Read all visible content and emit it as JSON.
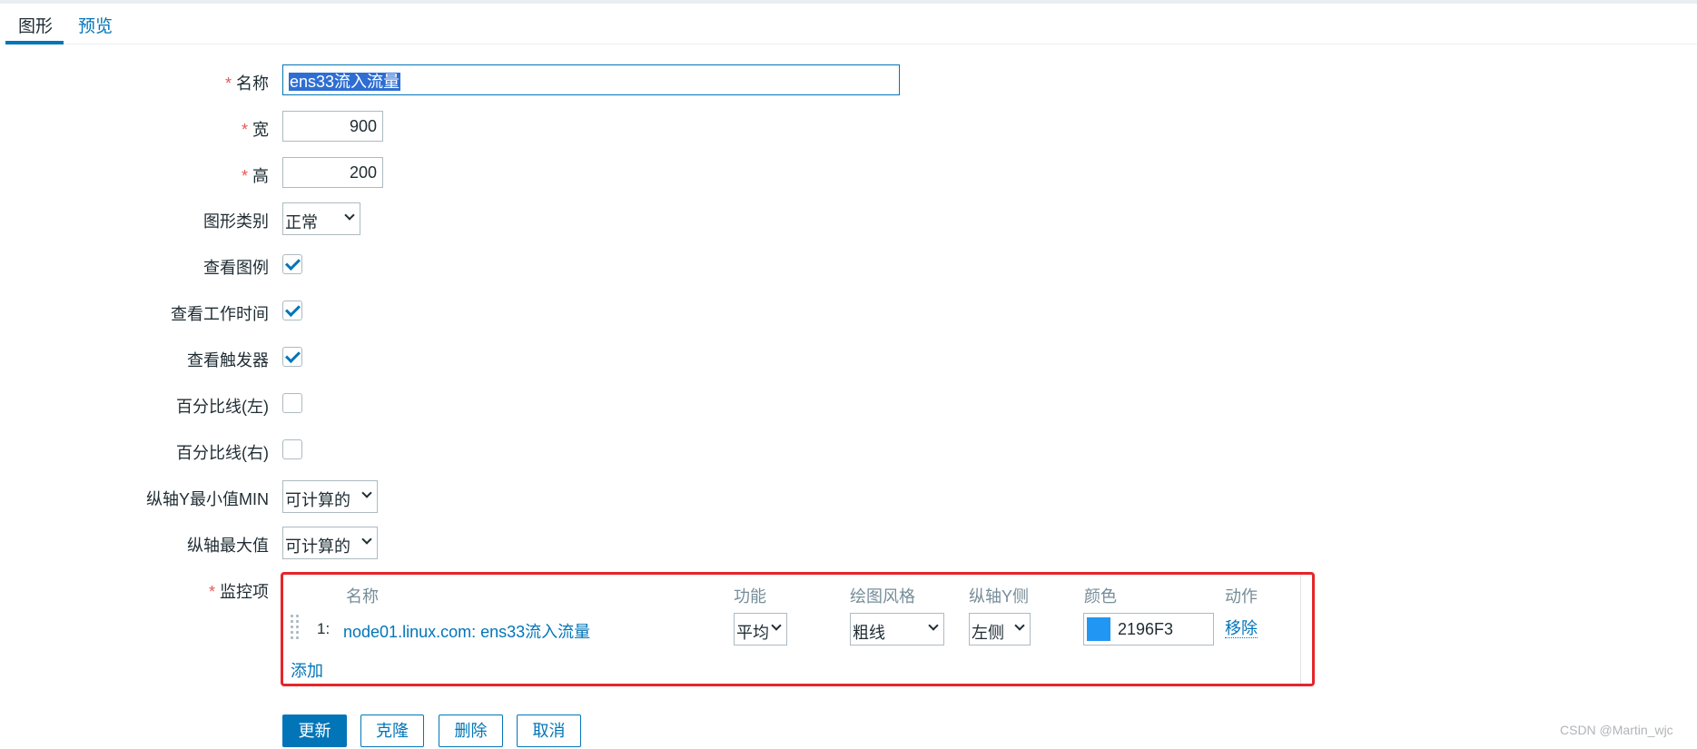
{
  "tabs": [
    {
      "label": "图形"
    },
    {
      "label": "预览"
    }
  ],
  "form": {
    "name": {
      "label": "名称",
      "value": "ens33流入流量"
    },
    "width": {
      "label": "宽",
      "value": "900"
    },
    "height": {
      "label": "高",
      "value": "200"
    },
    "graph_type": {
      "label": "图形类别",
      "value": "正常"
    },
    "show_legend": {
      "label": "查看图例",
      "checked": true
    },
    "show_working_time": {
      "label": "查看工作时间",
      "checked": true
    },
    "show_triggers": {
      "label": "查看触发器",
      "checked": true
    },
    "percentile_left": {
      "label": "百分比线(左)",
      "checked": false
    },
    "percentile_right": {
      "label": "百分比线(右)",
      "checked": false
    },
    "y_min": {
      "label": "纵轴Y最小值MIN",
      "value": "可计算的"
    },
    "y_max": {
      "label": "纵轴最大值",
      "value": "可计算的"
    },
    "items": {
      "label": "监控项",
      "headers": {
        "name": "名称",
        "function": "功能",
        "draw_style": "绘图风格",
        "y_axis_side": "纵轴Y侧",
        "color": "颜色",
        "action": "动作"
      },
      "rows": [
        {
          "index": "1:",
          "name": "node01.linux.com: ens33流入流量",
          "function": "平均",
          "draw_style": "粗线",
          "y_axis_side": "左侧",
          "color": "2196F3",
          "color_hex": "#2196F3",
          "action": "移除"
        }
      ],
      "add_label": "添加"
    },
    "required_mark": "*"
  },
  "buttons": {
    "update": "更新",
    "clone": "克隆",
    "delete": "删除",
    "cancel": "取消"
  },
  "watermark": "CSDN @Martin_wjc"
}
